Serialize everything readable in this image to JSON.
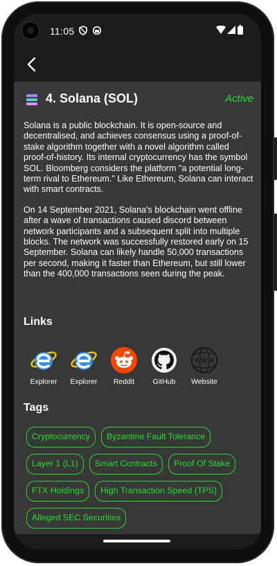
{
  "status_bar": {
    "time": "11:05",
    "left_icons": [
      "vpn-shield-icon",
      "data-saver-icon"
    ],
    "right_icons": [
      "wifi-icon",
      "signal-icon",
      "battery-icon"
    ]
  },
  "app_bar": {
    "back_icon": "chevron-left-icon"
  },
  "coin": {
    "title": "4. Solana (SOL)",
    "status": "Active",
    "description": [
      "Solana is a public blockchain. It is open-source and decentralised, and achieves consensus using a proof-of-stake algorithm together with a novel algorithm called proof-of-history. Its internal cryptocurrency has the symbol SOL. Bloomberg considers the platform \"a potential long-term rival to Ethereum.\" Like Ethereum, Solana can interact with smart contracts.",
      "On 14 September 2021, Solana's blockchain went offline after a wave of transactions caused discord between network participants and a subsequent split into multiple blocks. The network was successfully restored early on 15 September. Solana can likely handle 50,000 transactions per second, making it faster than Ethereum, but still lower than the 400,000 transactions seen during the peak."
    ]
  },
  "links": {
    "heading": "Links",
    "items": [
      {
        "label": "Explorer",
        "icon": "internet-explorer-icon"
      },
      {
        "label": "Explorer",
        "icon": "internet-explorer-icon"
      },
      {
        "label": "Reddit",
        "icon": "reddit-icon"
      },
      {
        "label": "GitHub",
        "icon": "github-icon"
      },
      {
        "label": "Website",
        "icon": "www-globe-icon"
      }
    ]
  },
  "tags": {
    "heading": "Tags",
    "items": [
      "Cryptocurrency",
      "Byzantine Fault Tolerance",
      "Layer 1 (L1)",
      "Smart Contracts",
      "Proof Of Stake",
      "FTX Holdings",
      "High Transaction Speed (TPS)",
      "Alleged SEC Securities"
    ]
  },
  "colors": {
    "accent_green": "#22e02b",
    "background": "#383838",
    "app_bar": "#1c1c1c"
  }
}
